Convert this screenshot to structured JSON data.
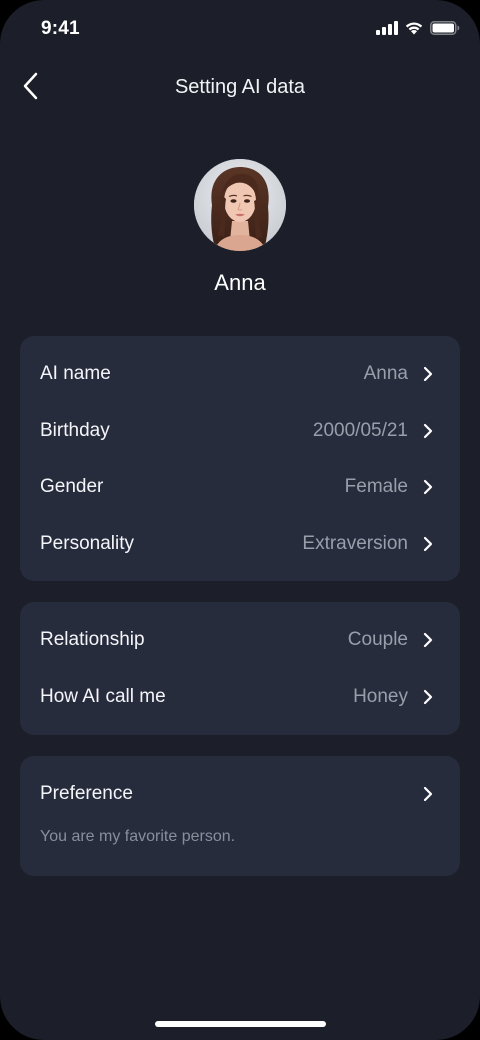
{
  "status_bar": {
    "time": "9:41"
  },
  "nav": {
    "title": "Setting AI data",
    "back_icon": "chevron-left-icon"
  },
  "profile": {
    "name": "Anna"
  },
  "ai_info": [
    {
      "label": "AI name",
      "value": "Anna"
    },
    {
      "label": "Birthday",
      "value": "2000/05/21"
    },
    {
      "label": "Gender",
      "value": "Female"
    },
    {
      "label": "Personality",
      "value": "Extraversion"
    }
  ],
  "relation": [
    {
      "label": "Relationship",
      "value": "Couple"
    },
    {
      "label": "How AI call me",
      "value": "Honey"
    }
  ],
  "preference": {
    "label": "Preference",
    "description": "You are my favorite person."
  },
  "colors": {
    "background": "#1c1f29",
    "card": "#272c3d",
    "text_primary": "#f4f5f8",
    "text_secondary": "#9a9eab"
  }
}
